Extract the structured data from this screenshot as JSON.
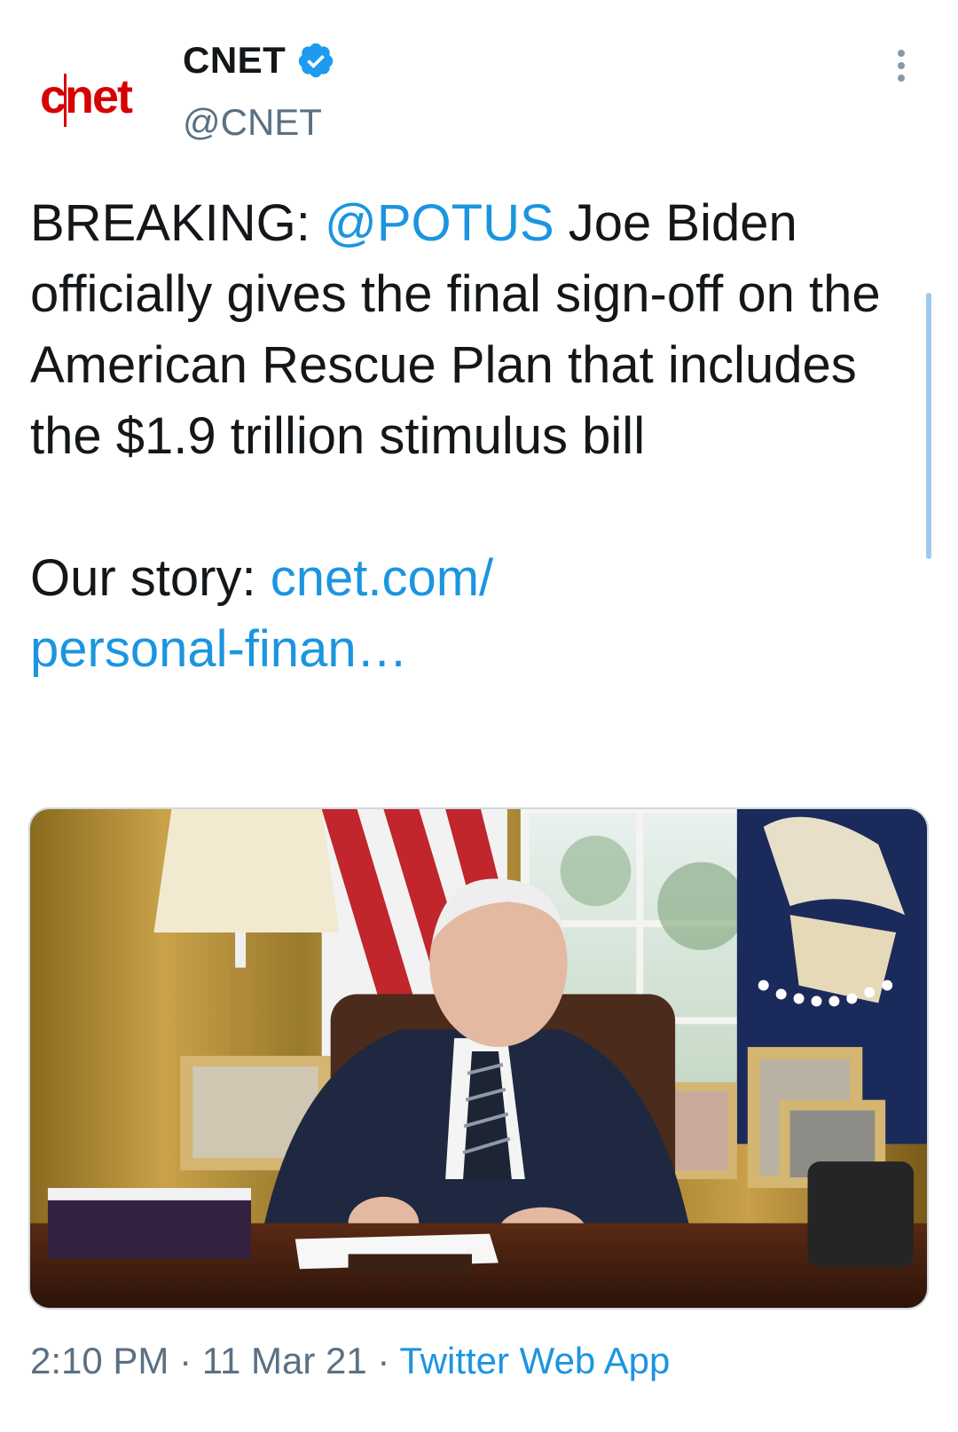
{
  "author": {
    "display_name": "CNET",
    "handle": "@CNET",
    "logo_text": "cnet",
    "logo_color": "#d60000",
    "verified_icon": "verified-badge-icon"
  },
  "tweet": {
    "prefix": "BREAKING: ",
    "mention": "@POTUS",
    "body": " Joe Biden officially gives the final sign-off on the American Rescue Plan that includes the $1.9 trillion stimulus bill",
    "story_label": "Our story: ",
    "story_link": "cnet.com/\npersonal-finan…"
  },
  "meta": {
    "time": "2:10 PM",
    "separator": " · ",
    "date": "11 Mar 21",
    "source": "Twitter Web App"
  },
  "colors": {
    "link": "#1b95e0",
    "secondary_text": "#5b7083",
    "text": "#14171a"
  }
}
